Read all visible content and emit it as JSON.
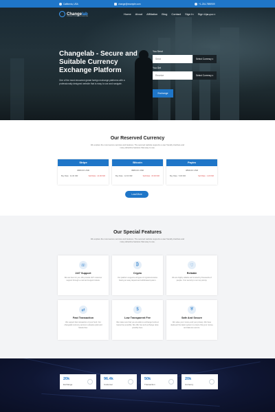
{
  "topbar": {
    "location": "California, USA",
    "email": "change@example.com",
    "phone": "+1-234-7890909"
  },
  "nav": {
    "logo_main": "Change",
    "logo_accent": "lab",
    "logo_tagline": "CURRENCY EXCHANGE PLATFORM",
    "items": [
      "Home",
      "About",
      "Affiliation",
      "Blog",
      "Contact",
      "Sign In",
      "Sign Up"
    ],
    "language": "English"
  },
  "hero": {
    "title": "Changelab - Secure and Suitable Currency Exchange Platform",
    "description": "One of the most renowned global foreign exchange platforms with a professionally designed website that is easy to use and navigate."
  },
  "exchange_form": {
    "send_label": "You Send",
    "send_value": "Send",
    "send_select": "Select Currency",
    "receive_label": "You Get",
    "receive_value": "Receive",
    "receive_select": "Select Currency",
    "button": "Exchange"
  },
  "reserved": {
    "title": "Our Reserved Currency",
    "subtitle": "We explore the most secure services and features. The secured website supports a user friendly interface and many attractive features that easy to use.",
    "cards": [
      {
        "name": "Stripe",
        "amount": "2983.03 USD",
        "buy": "Buy Rate : 11.00 INR",
        "sell": "Sell Rate : 14.00 INR"
      },
      {
        "name": "Bitcoin",
        "amount": "3983.03 USD",
        "buy": "Buy Rate : 12.00 INR",
        "sell": "Sell Rate : 15.00 INR"
      },
      {
        "name": "Paytm",
        "amount": "3839.03 USD",
        "buy": "Buy Rate : 5.00 INR",
        "sell": "Sell Rate : 1.20 INR"
      }
    ],
    "load_more": "Load More"
  },
  "features": {
    "title": "Our Special Features",
    "subtitle": "We explore the most secure services and features. The secured website supports a user friendly interface and many attractive features that easy to use.",
    "items": [
      {
        "title": "24/7 Support",
        "desc": "We are here for you. We provide 24/7 customer support through e-mail and support tickets.",
        "icon": "headset-icon",
        "glyph": "☏"
      },
      {
        "title": "Crypto",
        "desc": "Our platform supports all types of cryptocurrencies having an easy deposit and withdrawal system.",
        "icon": "crypto-icon",
        "glyph": "₿"
      },
      {
        "title": "Reliable",
        "desc": "We are highly reliable and trusted by thousands of people. Your security is our top priority.",
        "icon": "heart-icon",
        "glyph": "♡"
      },
      {
        "title": "Fast Transaction",
        "desc": "We support fast transaction of your fund. Our changelab currency service is already quick and hassle-free.",
        "icon": "transaction-icon",
        "glyph": "⇄"
      },
      {
        "title": "Low Transparent Fee",
        "desc": "We make sure that you are able to exchange funds at lowest fee possible. We offer low and exchange rates possibly fees.",
        "icon": "fee-icon",
        "glyph": "$"
      },
      {
        "title": "Safe And Secure",
        "desc": "We value your money and your privacy. We have deployed the latest system to ensure that your money and data are secure.",
        "icon": "shield-user-icon",
        "glyph": "⛨"
      }
    ]
  },
  "stats": [
    {
      "value": "20k",
      "label": "Exchange"
    },
    {
      "value": "96.4k",
      "label": "Customer"
    },
    {
      "value": "50k",
      "label": "Transaction"
    },
    {
      "value": "20k",
      "label": "Currency"
    }
  ],
  "colors": {
    "accent": "#1f76c8",
    "hero_dark": "#1a2a33",
    "footer_dark": "#0f1633"
  }
}
